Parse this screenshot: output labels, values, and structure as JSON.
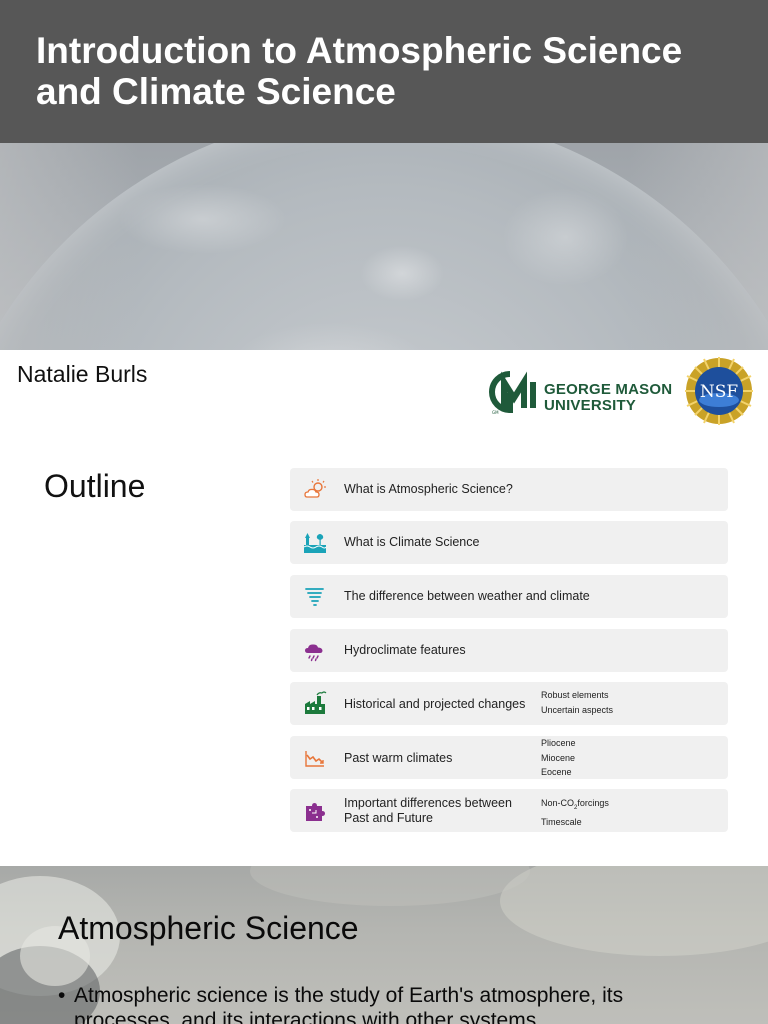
{
  "slide1": {
    "title": "Introduction to Atmospheric Science and Climate Science",
    "author": "Natalie Burls",
    "gmu_logo_text_line1": "GEORGE MASON",
    "gmu_logo_text_line2": "UNIVERSITY",
    "gmu_logo_mark": "GM",
    "nsf_logo_text": "NSF"
  },
  "outline": {
    "title": "Outline",
    "items": [
      {
        "label": "What is Atmospheric Science?",
        "icon": "partly-cloudy-icon",
        "subs": []
      },
      {
        "label": "What is Climate Science",
        "icon": "climate-scene-icon",
        "subs": []
      },
      {
        "label": "The difference between weather and climate",
        "icon": "tornado-icon",
        "subs": []
      },
      {
        "label": "Hydroclimate features",
        "icon": "rain-cloud-icon",
        "subs": []
      },
      {
        "label": "Historical and projected changes",
        "icon": "factory-icon",
        "subs": [
          "Robust elements",
          "Uncertain aspects"
        ]
      },
      {
        "label": "Past warm climates",
        "icon": "trend-chart-icon",
        "subs": [
          "Pliocene",
          "Miocene",
          "Eocene"
        ]
      },
      {
        "label_line1": "Important differences between",
        "label_line2": "Past and Future",
        "icon": "puzzle-icon",
        "subs": [
          "Non-CO",
          "Timescale"
        ],
        "sub_co2_subscript": "2",
        "sub_co2_tail": "forcings"
      }
    ]
  },
  "slide3": {
    "title": "Atmospheric Science",
    "bullet_symbol": "•",
    "bullet": "Atmospheric science is the study of Earth's atmosphere, its processes, and its interactions with other systems"
  },
  "colors": {
    "title_band": "#575757",
    "outline_item_bg": "#f0f0f0",
    "gmu_green": "#1f5a3a",
    "gmu_gold": "#c9a227",
    "icon_orange": "#e8763a",
    "icon_teal": "#1aa3b8",
    "icon_purple": "#8b2f8f",
    "icon_green": "#1c7a3c"
  }
}
